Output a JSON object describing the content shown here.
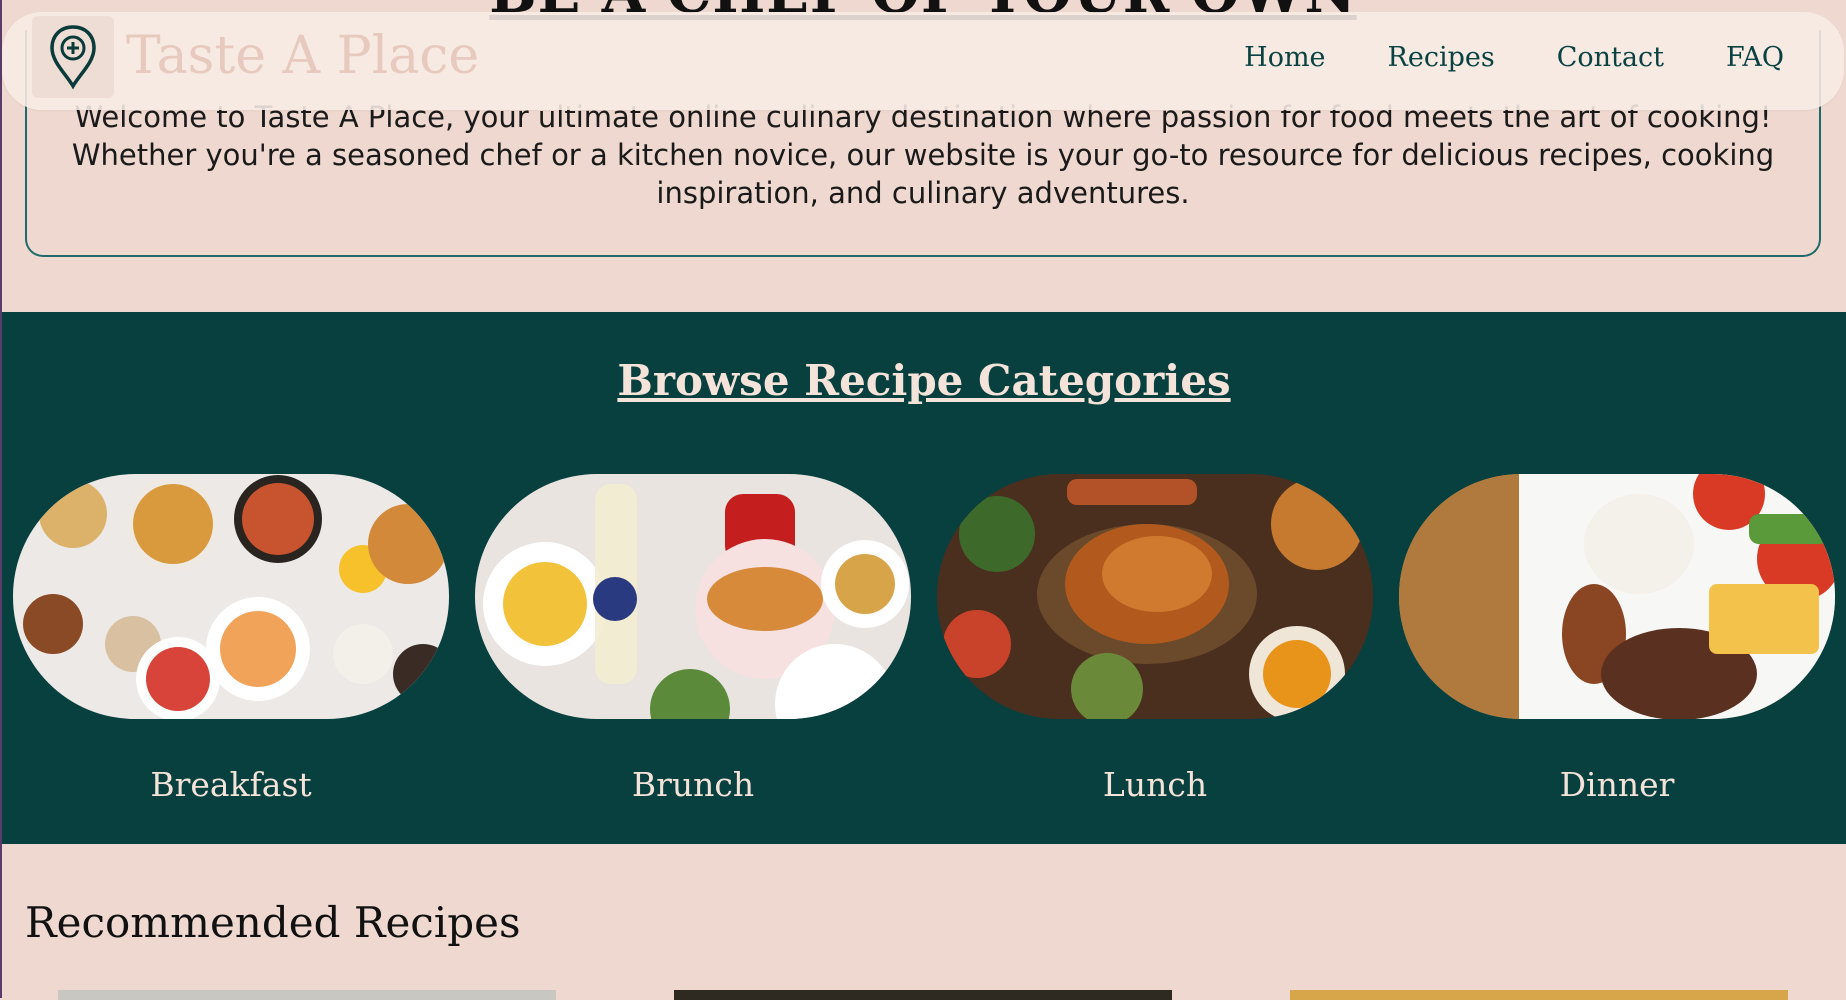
{
  "hero": {
    "heading": "BE A CHEF OF YOUR OWN"
  },
  "navbar": {
    "site_name": "Taste A Place",
    "links": [
      "Home",
      "Recipes",
      "Contact",
      "FAQ"
    ]
  },
  "intro": {
    "text": "Welcome to Taste A Place, your ultimate online culinary destination where passion for food meets the art of cooking! Whether you're a seasoned chef or a kitchen novice, our website is your go-to resource for delicious recipes, cooking inspiration, and culinary adventures."
  },
  "categories": {
    "title": "Browse Recipe Categories",
    "items": [
      {
        "label": "Breakfast"
      },
      {
        "label": "Brunch"
      },
      {
        "label": "Lunch"
      },
      {
        "label": "Dinner"
      }
    ]
  },
  "recommended": {
    "title": "Recommended Recipes"
  },
  "colors": {
    "page_bg": "#eed8cf",
    "accent_teal": "#084040",
    "nav_text": "#0a4242",
    "cream_text": "#f4e3d9"
  },
  "icons": {
    "logo": "map-pin-icon"
  }
}
